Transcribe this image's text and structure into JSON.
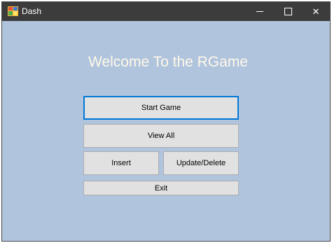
{
  "window": {
    "title": "Dash",
    "title_icon": "app-icon",
    "caption_buttons": {
      "minimize_icon": "minimize-icon",
      "maximize_icon": "maximize-icon",
      "close_icon": "close-icon",
      "close_glyph": "✕"
    }
  },
  "main": {
    "welcome_text": "Welcome To the RGame",
    "buttons": {
      "start": "Start Game",
      "view_all": "View All",
      "insert": "Insert",
      "update_delete": "Update/Delete",
      "exit": "Exit"
    }
  },
  "colors": {
    "background": "#b0c4de",
    "titlebar": "#3c3c3c",
    "welcome_text": "#fff8e7",
    "button_face": "#e1e1e1",
    "focus_border": "#0078d7"
  }
}
